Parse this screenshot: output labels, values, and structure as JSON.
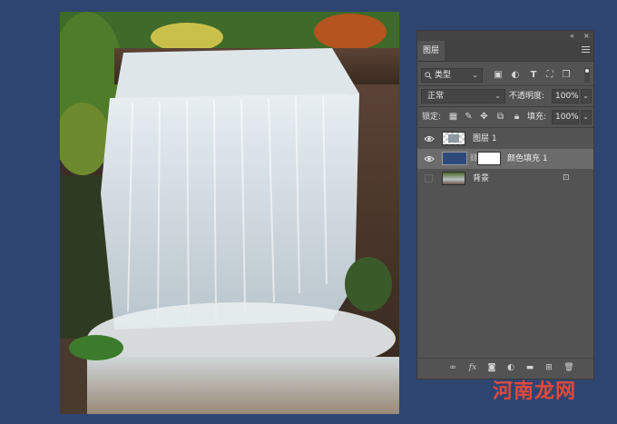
{
  "panel": {
    "tab_title": "图层",
    "collapse_glyph": "«",
    "close_glyph": "×",
    "filter": {
      "label": "类型",
      "icon": "search-icon"
    },
    "blend_mode": "正常",
    "opacity_label": "不透明度:",
    "opacity_value": "100%",
    "lock_label": "锁定:",
    "fill_label": "填充:",
    "fill_value": "100%",
    "layers": [
      {
        "name": "图层 1",
        "visible": true,
        "selected": false
      },
      {
        "name": "颜色填充 1",
        "visible": true,
        "selected": true,
        "fill_color": "#2d4a7a"
      },
      {
        "name": "背景",
        "visible": false,
        "selected": false,
        "locked": true
      }
    ],
    "footer_fx": "fx"
  },
  "watermark": {
    "text": "河南龙网"
  },
  "colors": {
    "background": "#2f4571",
    "panel": "#535353",
    "selected_row": "#6c6c6c",
    "watermark": "#e04a3a"
  }
}
